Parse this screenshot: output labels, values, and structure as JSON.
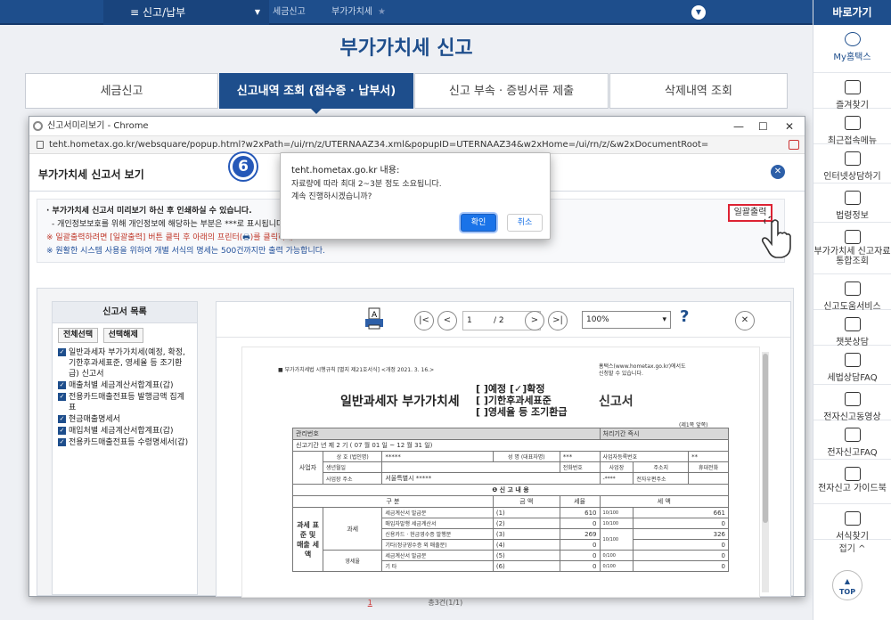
{
  "topnav": {
    "menu_label": "신고/납부",
    "crumbs": [
      "세금신고",
      "부가가치세"
    ]
  },
  "page_title": "부가가치세 신고",
  "tabs": [
    {
      "label": "세금신고"
    },
    {
      "label": "신고내역 조회 (접수증 · 납부서)"
    },
    {
      "label": "신고 부속 · 증빙서류 제출"
    },
    {
      "label": "삭제내역 조회"
    }
  ],
  "right_sidebar": {
    "head": "바로가기",
    "items": [
      {
        "label": "My홈택스"
      },
      {
        "label": "즐겨찾기"
      },
      {
        "label": "최근접속메뉴"
      },
      {
        "label": "인터넷상담하기"
      },
      {
        "label": "법령정보"
      },
      {
        "label": "부가가치세 신고자료 통합조회"
      },
      {
        "label": "신고도움서비스"
      },
      {
        "label": "챗봇상담"
      },
      {
        "label": "세법상담FAQ"
      },
      {
        "label": "전자신고동영상"
      },
      {
        "label": "전자신고FAQ"
      },
      {
        "label": "전자신고 가이드북"
      },
      {
        "label": "서식찾기"
      }
    ],
    "fold_label": "접기 ^",
    "top_label": "TOP"
  },
  "popup": {
    "window_title": "신고서미리보기 - Chrome",
    "url": "teht.hometax.go.kr/websquare/popup.html?w2xPath=/ui/rn/z/UTERNAAZ34.xml&popupID=UTERNAAZ34&w2xHome=/ui/rn/z/&w2xDocumentRoot=",
    "header_title": "부가가치세 신고서 보기",
    "notice": {
      "line1": "· 부가가치세 신고서 미리보기 하신 후 인쇄하실 수 있습니다.",
      "line2": "- 개인정보보호를 위해 개인정보에 해당하는 부분은 ***로 표시됩니다.",
      "line3": "※ 일괄출력하려면 [일괄출력] 버튼 클릭 후 아래의 프린터(",
      "line3b": ")를 클릭하세요.",
      "line4": "※ 원활한 시스템 사용을 위하여 개별 서식의 명세는 500건까지만 출력 가능합니다."
    },
    "bulk_print_label": "일괄출력",
    "list": {
      "title": "신고서 목록",
      "select_all": "전체선택",
      "deselect": "선택해제",
      "items": [
        "일반과세자 부가가치세(예정, 확정, 기한후과세표준, 영세율 등 조기환급) 신고서",
        "매출처별 세금계산서합계표(갑)",
        "전용카드매출전표등 발행금액 집계표",
        "현금매출명세서",
        "매입처별 세금계산서합계표(갑)",
        "전용카드매출전표등 수령명세서(갑)"
      ]
    },
    "viewer": {
      "page_value": "1",
      "page_total": "/ 2",
      "zoom": "100%",
      "help": "?"
    },
    "doc": {
      "law": "■ 부가가치세법 시행규칙 [별지 제21호서식] <개정 2021. 3. 16.>",
      "site1": "홈택스(www.hometax.go.kr)에서도",
      "site2": "신청할 수 있습니다.",
      "title_left": "일반과세자 부가가치세",
      "opt1": "[  ]예정 [✓]확정",
      "opt2": "[  ]기한후과세표준",
      "opt3": "[  ]영세율 등 조기환급",
      "title_right": "신고서",
      "page_note": "(제1쪽 앞쪽)",
      "rows": {
        "mgmt_no": "관리번호",
        "period_label": "처리기간 즉시",
        "period": "신고기간        년 제 2 기 ( 07 월    01 일 ~ 12 월    31 일)",
        "biz_label": "사업자",
        "name_label": "상 호 (법인명)",
        "name_val": "*****",
        "rep_label": "성 명 (대표자명)",
        "rep_val": "***",
        "regno_label": "사업자등록번호",
        "regno_val": "**",
        "birth_label": "생년월일",
        "phone_label": "전화번호",
        "office_label": "사업장",
        "home_label": "주소지",
        "mobile_label": "휴대전화",
        "phone_val": "-****",
        "addr_label": "사업장 주소",
        "addr_val": "서울특별시       *****",
        "email_label": "전자우편주소",
        "section": "❶ 신  고  내  용",
        "col_kind": "구        분",
        "col_amount": "금      액",
        "col_rate": "세율",
        "col_tax": "세      액",
        "tax_base_label": "과세 표준 및 매출 세액",
        "tax_label": "과세",
        "zero_label": "영세율",
        "r1": "세금계산서 발급분",
        "r1n": "(1)",
        "r1a": "610",
        "r1r": "10/100",
        "r1t": "661",
        "r2": "매입자발행 세금계산서",
        "r2n": "(2)",
        "r2a": "0",
        "r2r": "10/100",
        "r2t": "0",
        "r3": "신용카드 · 현금영수증 발행분",
        "r3n": "(3)",
        "r3a": "269",
        "r3r": "10/100",
        "r3t": "326",
        "r4": "기타(정규영수증 외 매출분)",
        "r4n": "(4)",
        "r4a": "0",
        "r4t": "0",
        "r5": "세금계산서 발급분",
        "r5n": "(5)",
        "r5a": "0",
        "r5r": "0/100",
        "r5t": "0",
        "r6": "기 타",
        "r6n": "(6)",
        "r6a": "0",
        "r6r": "0/100",
        "r6t": "0"
      }
    },
    "footer_page": "1",
    "footer_total": "총3건(1/1)"
  },
  "step_badge": "6",
  "alert": {
    "header": "teht.hometax.go.kr 내용:",
    "msg1": "자료량에 따라 최대 2~3분 정도 소요됩니다.",
    "msg2": "계속 진행하시겠습니까?",
    "ok": "확인",
    "cancel": "취소"
  },
  "colors": {
    "brand": "#1e4e8c",
    "alert_ok": "#1a73e8",
    "highlight_red": "#dd2233"
  }
}
